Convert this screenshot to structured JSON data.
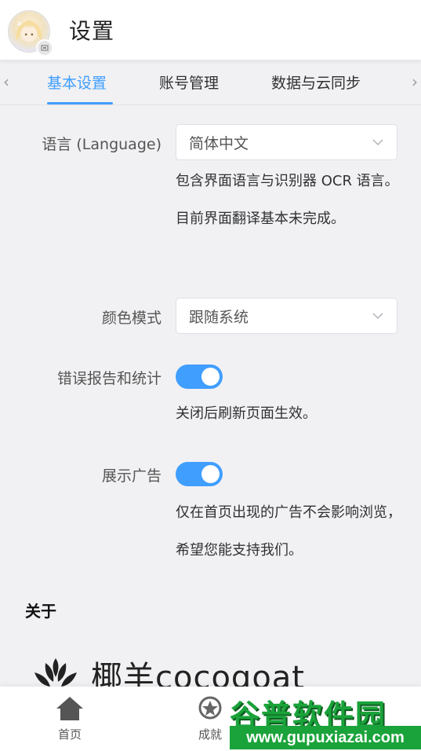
{
  "header": {
    "title": "设置"
  },
  "tabs": {
    "items": [
      {
        "label": "基本设置"
      },
      {
        "label": "账号管理"
      },
      {
        "label": "数据与云同步"
      }
    ],
    "active_index": 0
  },
  "settings": {
    "language": {
      "label": "语言 (Language)",
      "value": "简体中文",
      "help": "包含界面语言与识别器 OCR 语言。目前界面翻译基本未完成。"
    },
    "color_mode": {
      "label": "颜色模式",
      "value": "跟随系统"
    },
    "error_report": {
      "label": "错误报告和统计",
      "enabled": true,
      "help": "关闭后刷新页面生效。"
    },
    "ads": {
      "label": "展示广告",
      "enabled": true,
      "help": "仅在首页出现的广告不会影响浏览，希望您能支持我们。"
    }
  },
  "about": {
    "title": "关于",
    "brand_name": "椰羊cocogoat"
  },
  "bottom_nav": {
    "items": [
      {
        "label": "首页",
        "icon": "home-icon"
      },
      {
        "label": "成就",
        "icon": "achievement-icon"
      }
    ]
  },
  "watermark": {
    "line1": "谷普软件园",
    "line2": "www.gupuxiazai.com"
  },
  "colors": {
    "accent": "#409eff",
    "background": "#f1f1f3",
    "watermark_green": "#1aa33a"
  }
}
